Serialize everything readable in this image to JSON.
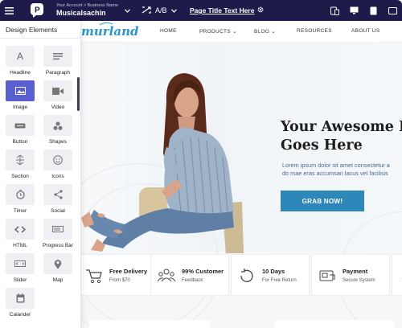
{
  "topbar": {
    "account_label": "Your Account > Business Name",
    "account_name": "Musicalsachin",
    "ab_label": "A/B",
    "page_title": "Page Title Text Here"
  },
  "panel": {
    "title": "Design Elements",
    "items": [
      {
        "label": "Headline",
        "icon": "headline-icon"
      },
      {
        "label": "Paragraph",
        "icon": "paragraph-icon"
      },
      {
        "label": "Image",
        "icon": "image-icon"
      },
      {
        "label": "Video",
        "icon": "video-icon"
      },
      {
        "label": "Button",
        "icon": "button-icon"
      },
      {
        "label": "Shapes",
        "icon": "shapes-icon"
      },
      {
        "label": "Section",
        "icon": "section-icon"
      },
      {
        "label": "Icons",
        "icon": "icons-icon"
      },
      {
        "label": "Timer",
        "icon": "timer-icon"
      },
      {
        "label": "Social",
        "icon": "social-icon"
      },
      {
        "label": "HTML",
        "icon": "html-icon"
      },
      {
        "label": "Progress Bar",
        "icon": "progress-bar-icon"
      },
      {
        "label": "Slider",
        "icon": "slider-icon"
      },
      {
        "label": "Map",
        "icon": "map-icon"
      },
      {
        "label": "Calander",
        "icon": "calendar-icon"
      }
    ],
    "headline_glyph": "A"
  },
  "site": {
    "brand": "murland",
    "nav": [
      "HOME",
      "PRODUCTS",
      "BLOG",
      "RESOURCES",
      "ABOUT US"
    ],
    "hero": {
      "headline_line1": "Your Awesome H",
      "headline_line2": "Goes Here",
      "sub_line1": "Lorem ipsum dolor sit amet consectetur a",
      "sub_line2": "do mae eras accumsan lacus vel facilisis",
      "button": "GRAB NOW!"
    },
    "features": [
      {
        "title": "Free Delivery",
        "sub": "From $70"
      },
      {
        "title": "99% Customer",
        "sub": "Feedback"
      },
      {
        "title": "10 Days",
        "sub": "For Free Return"
      },
      {
        "title": "Payment",
        "sub": "Secure System"
      }
    ]
  },
  "colors": {
    "topbar": "#1e1a4a",
    "accent": "#5a5fd0",
    "brand": "#2a97c8",
    "button": "#2d87b9"
  }
}
